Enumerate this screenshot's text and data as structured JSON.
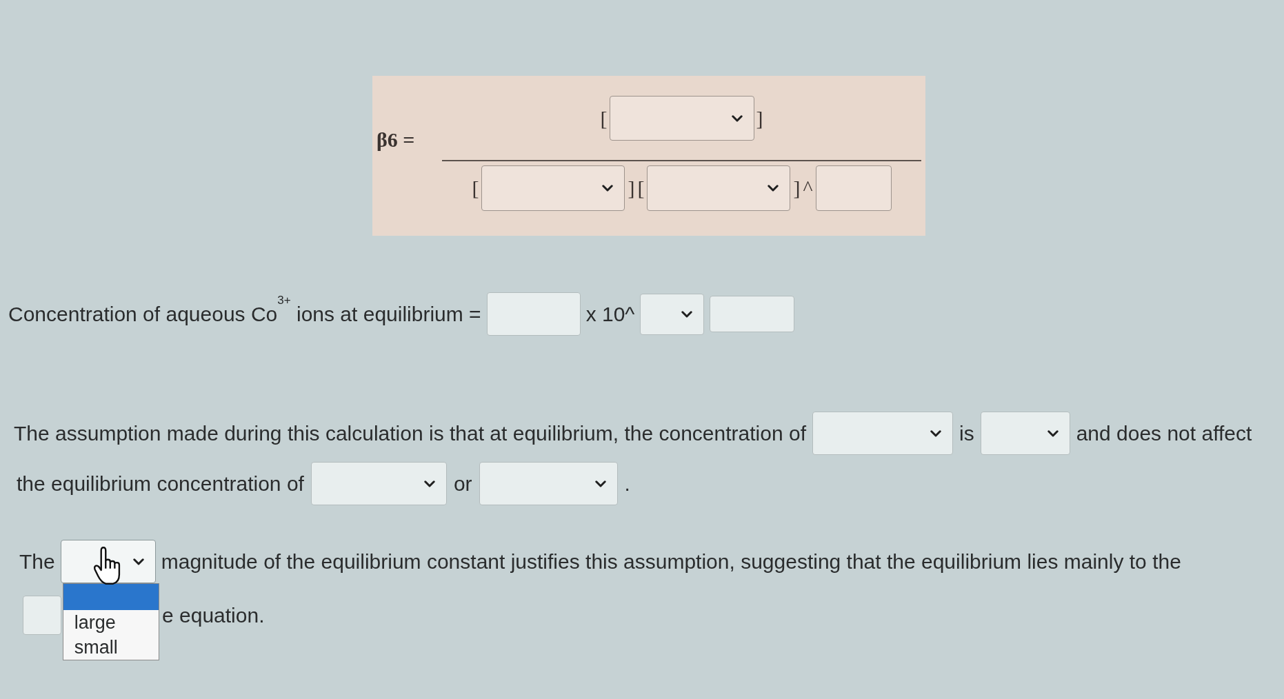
{
  "formula": {
    "label": "β6 =",
    "numerator": [
      {
        "kind": "text",
        "text": "["
      },
      {
        "kind": "dropdown",
        "expanded": false
      },
      {
        "kind": "text",
        "text": "]"
      }
    ],
    "denominator": [
      {
        "kind": "text",
        "text": "["
      },
      {
        "kind": "dropdown",
        "expanded": false
      },
      {
        "kind": "text",
        "text": "]"
      },
      {
        "kind": "text",
        "text": "["
      },
      {
        "kind": "dropdown",
        "expanded": false
      },
      {
        "kind": "text",
        "text": "]"
      },
      {
        "kind": "text",
        "text": "^"
      },
      {
        "kind": "input"
      }
    ]
  },
  "lines": [
    [
      {
        "kind": "text",
        "text": "Concentration of aqueous Co$^{3+}$ ions at equilibrium ="
      },
      {
        "kind": "input"
      },
      {
        "kind": "text",
        "text": "x 10^"
      },
      {
        "kind": "dropdown",
        "expanded": false
      },
      {
        "kind": "input"
      }
    ],
    [
      {
        "kind": "text",
        "text": "The assumption made during this calculation is that at equilibrium, the concentration of"
      },
      {
        "kind": "dropdown",
        "expanded": false
      },
      {
        "kind": "text",
        "text": "is"
      },
      {
        "kind": "dropdown",
        "expanded": false
      },
      {
        "kind": "text",
        "text": "and does not affect"
      }
    ],
    [
      {
        "kind": "text",
        "text": "the equilibrium concentration of"
      },
      {
        "kind": "dropdown",
        "expanded": false
      },
      {
        "kind": "text",
        "text": "or"
      },
      {
        "kind": "dropdown",
        "expanded": false
      },
      {
        "kind": "text",
        "text": "."
      }
    ],
    [
      {
        "kind": "text",
        "text": "The"
      },
      {
        "kind": "dropdown",
        "expanded": true,
        "pointer_over": true,
        "options": [
          {
            "kind": "blank",
            "selected": true
          },
          {
            "kind": "option",
            "label": "large",
            "selected": false
          },
          {
            "kind": "option",
            "label": "small",
            "selected": false
          }
        ]
      },
      {
        "kind": "text",
        "text": "magnitude of the equilibrium constant justifies this assumption, suggesting that the equilibrium lies mainly to the"
      }
    ],
    [
      {
        "kind": "input"
      },
      {
        "kind": "text",
        "text": "e equation."
      }
    ]
  ]
}
